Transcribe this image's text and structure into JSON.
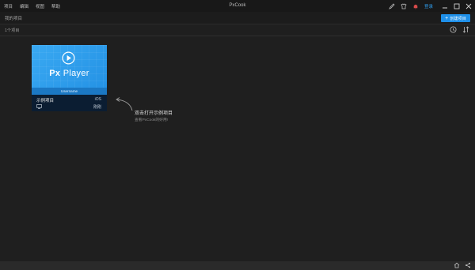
{
  "menu": [
    "项目",
    "编辑",
    "视图",
    "帮助"
  ],
  "app_title": "PxCook",
  "login_label": "登录",
  "breadcrumb": "我的项目",
  "create_button_label": "创建项目",
  "project_count": "1个项目",
  "project": {
    "thumb_brand_px": "Px",
    "thumb_brand_rest": "Player",
    "thumb_caption": "Username",
    "name": "示例项目",
    "platform": "iOS",
    "time": "刚刚"
  },
  "hint": {
    "title": "双击打开示例项目",
    "subtitle": "查看PxCook的好用!"
  },
  "colors": {
    "accent": "#1e8fe8",
    "thumb": "#2f9df0",
    "card_footer": "#0b1d32"
  },
  "icons": [
    "pen-icon",
    "shirt-icon",
    "bell-icon",
    "minimize-icon",
    "maximize-icon",
    "close-icon",
    "clock-icon",
    "sort-icon",
    "home-icon",
    "share-icon",
    "play-icon",
    "monitor-icon"
  ]
}
